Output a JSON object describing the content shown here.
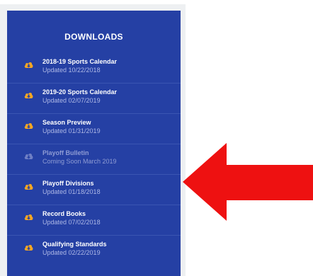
{
  "downloads": {
    "title": "DOWNLOADS",
    "items": [
      {
        "name": "2018-19 Sports Calendar",
        "status": "Updated 10/22/2018",
        "icon": "cloud-download-icon",
        "enabled": true
      },
      {
        "name": "2019-20 Sports Calendar",
        "status": "Updated 02/07/2019",
        "icon": "cloud-download-icon",
        "enabled": true
      },
      {
        "name": "Season Preview",
        "status": "Updated 01/31/2019",
        "icon": "cloud-download-icon",
        "enabled": true
      },
      {
        "name": "Playoff Bulletin",
        "status": "Coming Soon March 2019",
        "icon": "cloud-download-icon",
        "enabled": false
      },
      {
        "name": "Playoff Divisions",
        "status": "Updated 01/18/2018",
        "icon": "cloud-download-icon",
        "enabled": true
      },
      {
        "name": "Record Books",
        "status": "Updated 07/02/2018",
        "icon": "cloud-download-icon",
        "enabled": true
      },
      {
        "name": "Qualifying Standards",
        "status": "Updated 02/22/2019",
        "icon": "cloud-download-icon",
        "enabled": true
      }
    ]
  },
  "colors": {
    "panel": "#2540a4",
    "icon_active": "#f5a623",
    "icon_disabled": "#6f7fc4",
    "arrow": "#ee1111"
  }
}
